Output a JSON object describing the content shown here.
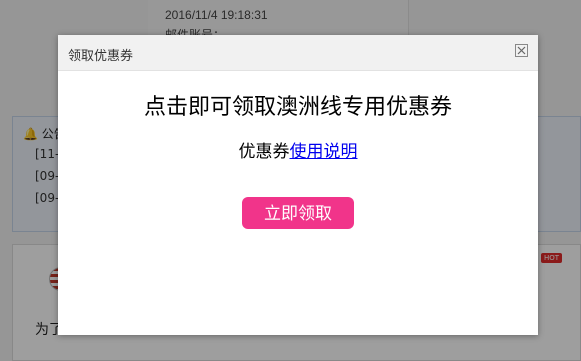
{
  "background": {
    "datetime": "2016/11/4 19:18:31",
    "email_label": "邮件账号：",
    "notice": {
      "title": "公告",
      "rows": [
        "[11-",
        "[09-",
        "[09-"
      ]
    },
    "hot_badge": "HOT",
    "bottom_text": "为了"
  },
  "dialog": {
    "title": "领取优惠券",
    "headline": "点击即可领取澳洲线专用优惠券",
    "subline_prefix": "优惠券",
    "subline_link": "使用说明",
    "claim_button": "立即领取"
  },
  "colors": {
    "overlay": "rgba(0,0,0,0.38)",
    "claim_button": "#f1348a",
    "link": "#0000ee"
  }
}
